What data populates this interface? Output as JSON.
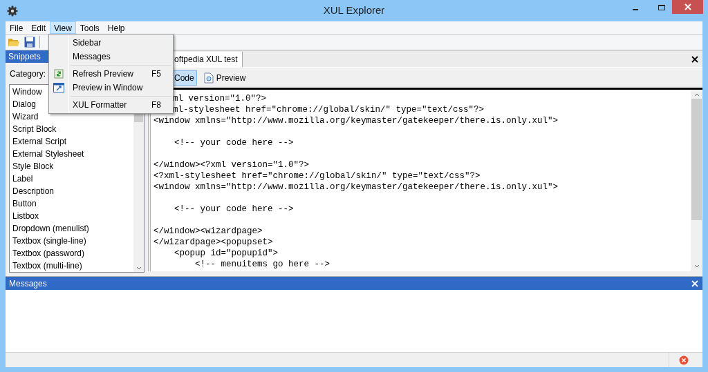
{
  "window": {
    "title": "XUL Explorer"
  },
  "menubar": [
    {
      "label": "File",
      "selected": false
    },
    {
      "label": "Edit",
      "selected": false
    },
    {
      "label": "View",
      "selected": true
    },
    {
      "label": "Tools",
      "selected": false
    },
    {
      "label": "Help",
      "selected": false
    }
  ],
  "open_menu": {
    "items": [
      {
        "kind": "item",
        "label": "Sidebar"
      },
      {
        "kind": "item",
        "label": "Messages"
      },
      {
        "kind": "separator"
      },
      {
        "kind": "item",
        "label": "Refresh Preview",
        "shortcut": "F5"
      },
      {
        "kind": "item",
        "label": "Preview in Window"
      },
      {
        "kind": "separator"
      },
      {
        "kind": "item",
        "label": "XUL Formatter",
        "shortcut": "F8"
      }
    ]
  },
  "sidebar": {
    "title": "Snippets",
    "category_label": "Category:",
    "items": [
      "Window",
      "Dialog",
      "Wizard",
      "Script Block",
      "External Script",
      "External Stylesheet",
      "Style Block",
      "Label",
      "Description",
      "Button",
      "Listbox",
      "Dropdown (menulist)",
      "Textbox (single-line)",
      "Textbox (password)",
      "Textbox (multi-line)"
    ]
  },
  "editor": {
    "tab": "oftpedia XUL test",
    "views": [
      {
        "label": "Code",
        "selected": true
      },
      {
        "label": "Preview",
        "selected": false
      }
    ],
    "code": "ml version=\"1.0\"?>\nml-stylesheet href=\"chrome://global/skin/\" type=\"text/css\"?>\n<window xmlns=\"http://www.mozilla.org/keymaster/gatekeeper/there.is.only.xul\">\n\n    <!-- your code here -->\n\n</window><?xml version=\"1.0\"?>\n<?xml-stylesheet href=\"chrome://global/skin/\" type=\"text/css\"?>\n<window xmlns=\"http://www.mozilla.org/keymaster/gatekeeper/there.is.only.xul\">\n\n    <!-- your code here -->\n\n</window><wizardpage>\n</wizardpage><popupset>\n    <popup id=\"popupid\">\n        <!-- menuitems go here -->"
  },
  "messages": {
    "title": "Messages"
  }
}
